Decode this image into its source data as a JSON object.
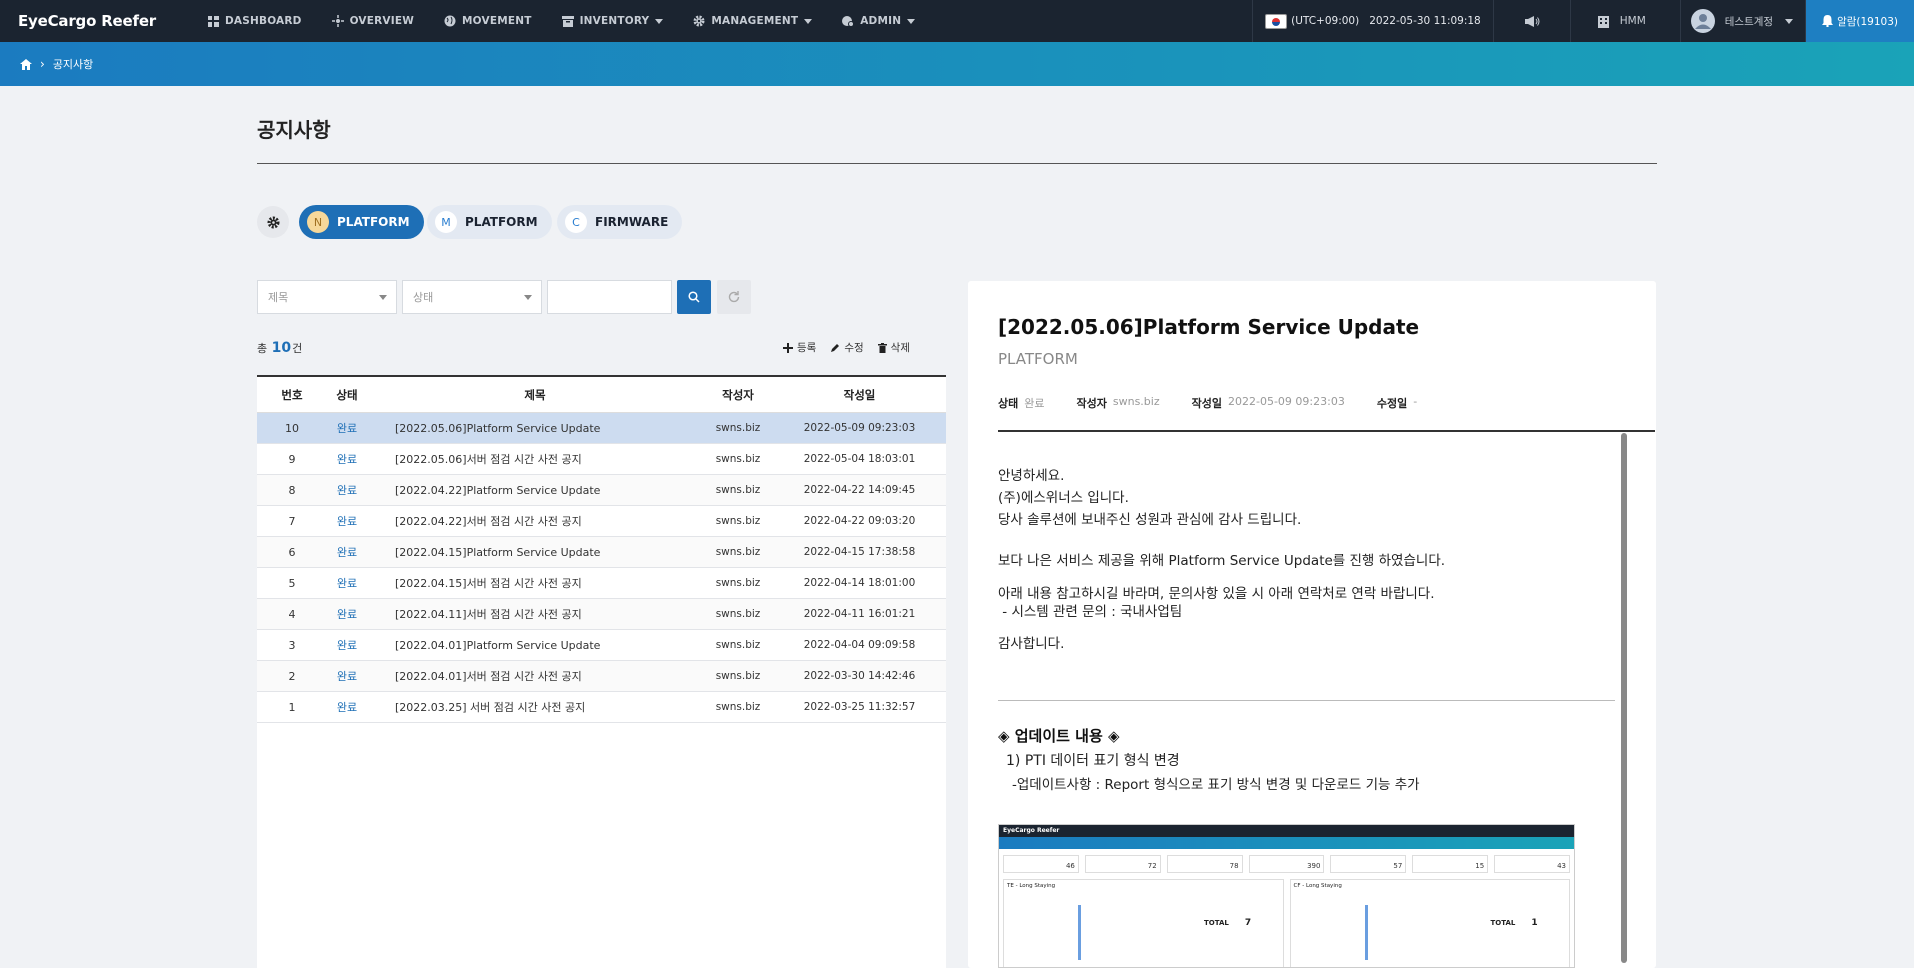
{
  "app": {
    "logo": "EyeCargo Reefer"
  },
  "nav": [
    {
      "label": "DASHBOARD",
      "icon": "dashboard-icon",
      "has_caret": false
    },
    {
      "label": "OVERVIEW",
      "icon": "overview-icon",
      "has_caret": false
    },
    {
      "label": "MOVEMENT",
      "icon": "globe-icon",
      "has_caret": false
    },
    {
      "label": "INVENTORY",
      "icon": "box-icon",
      "has_caret": true
    },
    {
      "label": "MANAGEMENT",
      "icon": "gear-icon",
      "has_caret": true
    },
    {
      "label": "ADMIN",
      "icon": "admin-icon",
      "has_caret": true
    }
  ],
  "header": {
    "timezone": "(UTC+09:00)",
    "datetime": "2022-05-30 11:09:18",
    "company": "HMM",
    "user": "테스트계정",
    "alarm": "알람(19103)"
  },
  "breadcrumb": {
    "current": "공지사항"
  },
  "page": {
    "title": "공지사항"
  },
  "categories": [
    {
      "badge": "N",
      "label": "PLATFORM",
      "active": true
    },
    {
      "badge": "M",
      "label": "PLATFORM",
      "active": false
    },
    {
      "badge": "C",
      "label": "FIRMWARE",
      "active": false
    }
  ],
  "filters": {
    "title_placeholder": "제목",
    "status_placeholder": "상태"
  },
  "list": {
    "count_prefix": "총",
    "count": "10",
    "count_suffix": "건",
    "add": "등록",
    "edit": "수정",
    "delete": "삭제",
    "columns": [
      "번호",
      "상태",
      "제목",
      "작성자",
      "작성일"
    ],
    "rows": [
      {
        "no": "10",
        "status": "완료",
        "title": "[2022.05.06]Platform Service Update",
        "author": "swns.biz",
        "date": "2022-05-09 09:23:03"
      },
      {
        "no": "9",
        "status": "완료",
        "title": "[2022.05.06]서버 점검 시간 사전 공지",
        "author": "swns.biz",
        "date": "2022-05-04 18:03:01"
      },
      {
        "no": "8",
        "status": "완료",
        "title": "[2022.04.22]Platform Service Update",
        "author": "swns.biz",
        "date": "2022-04-22 14:09:45"
      },
      {
        "no": "7",
        "status": "완료",
        "title": "[2022.04.22]서버 점검 시간 사전 공지",
        "author": "swns.biz",
        "date": "2022-04-22 09:03:20"
      },
      {
        "no": "6",
        "status": "완료",
        "title": "[2022.04.15]Platform Service Update",
        "author": "swns.biz",
        "date": "2022-04-15 17:38:58"
      },
      {
        "no": "5",
        "status": "완료",
        "title": "[2022.04.15]서버 점검 시간 사전 공지",
        "author": "swns.biz",
        "date": "2022-04-14 18:01:00"
      },
      {
        "no": "4",
        "status": "완료",
        "title": "[2022.04.11]서버 점검 시간 사전 공지",
        "author": "swns.biz",
        "date": "2022-04-11 16:01:21"
      },
      {
        "no": "3",
        "status": "완료",
        "title": "[2022.04.01]Platform Service Update",
        "author": "swns.biz",
        "date": "2022-04-04 09:09:58"
      },
      {
        "no": "2",
        "status": "완료",
        "title": "[2022.04.01]서버 점검 시간 사전 공지",
        "author": "swns.biz",
        "date": "2022-03-30 14:42:46"
      },
      {
        "no": "1",
        "status": "완료",
        "title": "[2022.03.25] 서버 점검 시간 사전 공지",
        "author": "swns.biz",
        "date": "2022-03-25 11:32:57"
      }
    ]
  },
  "detail": {
    "title": "[2022.05.06]Platform Service Update",
    "category": "PLATFORM",
    "status_label": "상태",
    "status": "완료",
    "author_label": "작성자",
    "author": "swns.biz",
    "created_label": "작성일",
    "created": "2022-05-09 09:23:03",
    "modified_label": "수정일",
    "modified": "-",
    "body": {
      "greeting": "안녕하세요.",
      "company": "(주)에스위너스 입니다.",
      "thanks": "당사 솔루션에 보내주신 성원과 관심에 감사 드립니다.",
      "update_notice": "보다 나은 서비스 제공을 위해 Platform Service Update를 진행 하였습니다.",
      "contact": "아래 내용 참고하시길 바라며, 문의사항 있을 시 아래 연락처로 연락 바랍니다.",
      "contact_item": " - 시스템 관련 문의 : 국내사업팀",
      "closing": "감사합니다."
    },
    "update_heading": "◈ 업데이트 내용 ◈",
    "update_item": "1) PTI 데이터 표기 형식 변경",
    "update_detail": "-업데이트사항 : Report 형식으로 표기 방식 변경 및 다운로드 기능 추가",
    "screenshot": {
      "logo": "EyeCargo Reefer",
      "tiles": [
        "46",
        "72",
        "78",
        "390",
        "57",
        "15",
        "43"
      ],
      "chart1_title": "TE - Long Staying",
      "chart2_title": "CF - Long Staying",
      "total_label": "TOTAL",
      "total1": "7",
      "total2": "1"
    }
  }
}
